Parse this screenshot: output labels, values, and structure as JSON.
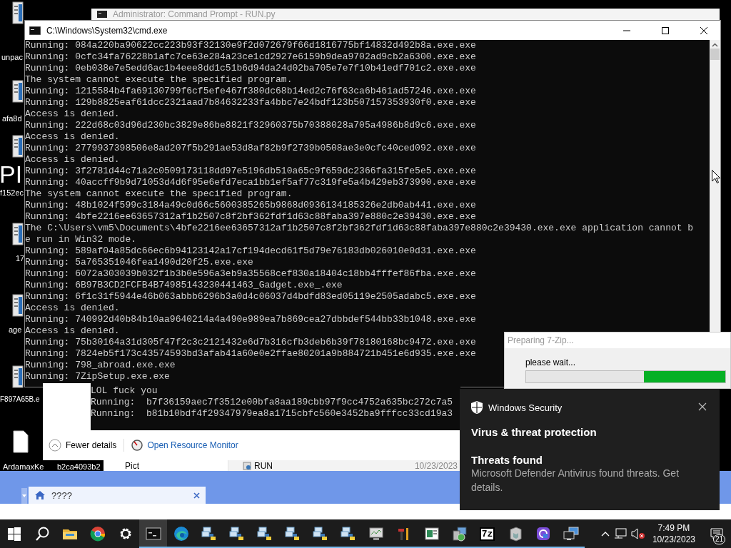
{
  "desktop": {
    "wallpaper_text": "PI",
    "icons": [
      {
        "label": "unpac"
      },
      {
        "label": "afa8d"
      },
      {
        "label": "f152ec"
      },
      {
        "label": "17"
      },
      {
        "label": "age"
      },
      {
        "label": "F897A65B.e"
      },
      {
        "label": "ArdamaxKe"
      },
      {
        "label": "b2ca4093b2"
      }
    ]
  },
  "background_window": {
    "title": "Administrator: Command Prompt - RUN.py"
  },
  "cmd_window": {
    "title": "C:\\Windows\\System32\\cmd.exe",
    "lines": [
      "Running: 084a220ba90622cc223b93f32130e9f2d072679f66d1816775bf14832d492b8a.exe.exe",
      "Running: 0cfc34fa76228b1afc7ce63e284a23ce1cd2927e6159b9dea9702ad9cb2a6300.exe.exe",
      "Running: 0eb038e7e5edd6ac1b4eee8dd1c51b6d94da24d02ba705e7e7f10b41edf701c2.exe.exe",
      "The system cannot execute the specified program.",
      "Running: 1215584b4fa69130799f6cf5efe467f380dc68b14ed2c76f63ca6b461ad57246.exe.exe",
      "Running: 129b8825eaf61dcc2321aad7b84632233fa4bbc7e24bdf123b507157353930f0.exe.exe",
      "Access is denied.",
      "Running: 222d68c03d96d230bc3829e86be8821f32960375b70388028a705a4986b8d9c6.exe.exe",
      "Access is denied.",
      "Running: 2779937398506e8ad207f5b291ae53d8af82b9f2739b0508ae3e0cfc40ced092.exe.exe",
      "Access is denied.",
      "Running: 3f2781d44c71a2c0509173118dd97e5196db510a65c9f659dc2366fa315fe5e5.exe.exe",
      "Running: 40accff9b9d71053d4d6f95e6efd7eca1bb1ef5af77c319fe5a4b429eb373990.exe.exe",
      "The system cannot execute the specified program.",
      "Running: 48b1024f599c3184a49c0d66c5600385265b9868d0936134185326e2db0ab441.exe.exe",
      "Running: 4bfe2216ee63657312af1b2507c8f2bf362fdf1d63c88faba397e880c2e39430.exe.exe",
      "The C:\\Users\\vm5\\Documents\\4bfe2216ee63657312af1b2507c8f2bf362fdf1d63c88faba397e880c2e39430.exe.exe application cannot b",
      "e run in Win32 mode.",
      "Running: 589af04a85dc66ec6b94123142a17cf194decd61f5d79e76183db026010e0d31.exe.exe",
      "Running: 5a765351046fea1490d20f25.exe.exe",
      "Running: 6072a303039b032f1b3b0e596a3eb9a35568cef830a18404c18bb4fffef86fba.exe.exe",
      "Running: 6B97B3CD2FCFB4B74985143230441463_Gadget.exe_.exe",
      "Running: 6f1c31f5944e46b063abbb6296b3a0d4c06037d4bdfd83ed05119e2505adabc5.exe.exe",
      "Access is denied.",
      "Running: 740992d40b84b10aa9640214a4a490e989ea7b869cea27dbbdef544bb33b1048.exe.exe",
      "Access is denied.",
      "Running: 75b30164a31d305f47f2c3c2121432e6d7b316cfb3deb6b39f78180168bc9472.exe.exe",
      "Running: 7824eb5f173c43574593bd3afab41a60e0e2ffae80201a9b884721b451e6d935.exe.exe",
      "Running: 798_abroad.exe.exe",
      "Running: 7ZipSetup.exe.exe"
    ]
  },
  "task_manager": {
    "console_lines": [
      "LOL fuck you",
      "Running:  b7f36159aec7f3512e00bfa8aa189cbb97f9cc4752a635bc272c7a5",
      "Running:  b81b10bdf4f29347979ea8a1715cbfc560e3452ba9fffcc33cd19a3"
    ],
    "fewer_details": "Fewer details",
    "resource_monitor": "Open Resource Monitor"
  },
  "explorer": {
    "sidebar_item": "Pict",
    "file": {
      "name": "RUN",
      "date": "10/23/2023"
    }
  },
  "browser": {
    "tabs": [
      {
        "label": "????",
        "selected": true
      }
    ]
  },
  "zip_dialog": {
    "title": "Preparing 7-Zip...",
    "message": "please wait...",
    "level": 0.41
  },
  "toast": {
    "app": "Windows Security",
    "title": "Virus & threat protection",
    "heading": "Threats found",
    "body": "Microsoft Defender Antivirus found threats. Get details."
  },
  "taskbar": {
    "items": [
      {
        "kind": "start",
        "active": false,
        "running": false
      },
      {
        "kind": "search",
        "active": false,
        "running": false
      },
      {
        "kind": "folder",
        "active": false,
        "running": false
      },
      {
        "kind": "chrome",
        "active": false,
        "running": false
      },
      {
        "kind": "gear",
        "active": false,
        "running": false
      },
      {
        "kind": "terminal",
        "active": true,
        "running": true
      },
      {
        "kind": "edge",
        "active": false,
        "running": true
      },
      {
        "kind": "python",
        "active": false,
        "running": true
      },
      {
        "kind": "python",
        "active": false,
        "running": true
      },
      {
        "kind": "python",
        "active": false,
        "running": true
      },
      {
        "kind": "python",
        "active": false,
        "running": true
      },
      {
        "kind": "python",
        "active": false,
        "running": true
      },
      {
        "kind": "python",
        "active": false,
        "running": true
      },
      {
        "kind": "monitor",
        "active": false,
        "running": true
      },
      {
        "kind": "tools",
        "active": false,
        "running": true
      },
      {
        "kind": "panel",
        "active": false,
        "running": true
      },
      {
        "kind": "setup",
        "active": false,
        "running": true
      },
      {
        "kind": "zip",
        "label": "7z",
        "active": false,
        "running": true
      },
      {
        "kind": "package",
        "active": false,
        "running": true
      },
      {
        "kind": "app",
        "active": false,
        "running": true
      },
      {
        "kind": "computers",
        "active": false,
        "running": true
      }
    ],
    "clock": {
      "time": "7:49 PM",
      "date": "10/23/2023"
    },
    "notifications": "21"
  }
}
